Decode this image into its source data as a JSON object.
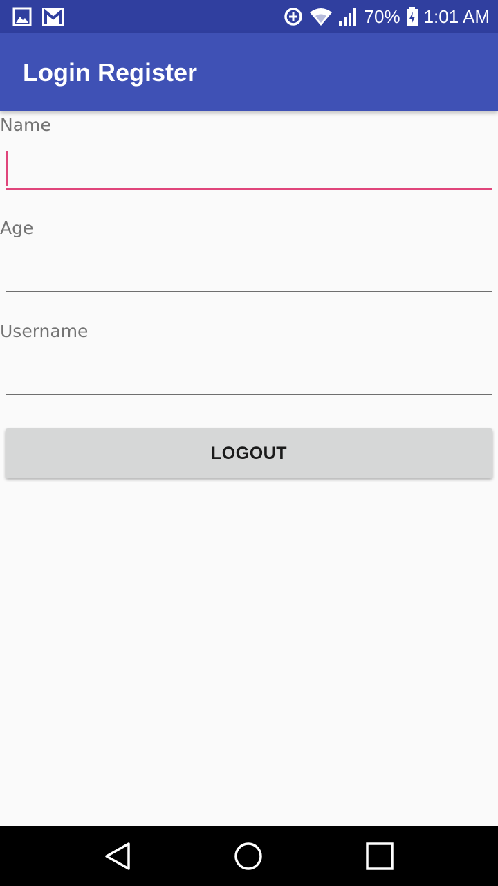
{
  "status_bar": {
    "battery": "70%",
    "time": "1:01 AM",
    "icons": [
      "image-icon",
      "gmail-icon",
      "data-saver-icon",
      "wifi-icon",
      "signal-icon",
      "battery-charging-icon"
    ]
  },
  "app_bar": {
    "title": "Login Register"
  },
  "form": {
    "name_label": "Name",
    "name_value": "",
    "age_label": "Age",
    "age_value": "",
    "username_label": "Username",
    "username_value": ""
  },
  "buttons": {
    "logout_label": "LOGOUT"
  },
  "nav_bar": {
    "icons": [
      "back-icon",
      "home-icon",
      "recents-icon"
    ]
  },
  "colors": {
    "status_bar": "#303f9f",
    "app_bar": "#3f51b5",
    "accent": "#e0457b",
    "button": "#d6d7d7"
  }
}
